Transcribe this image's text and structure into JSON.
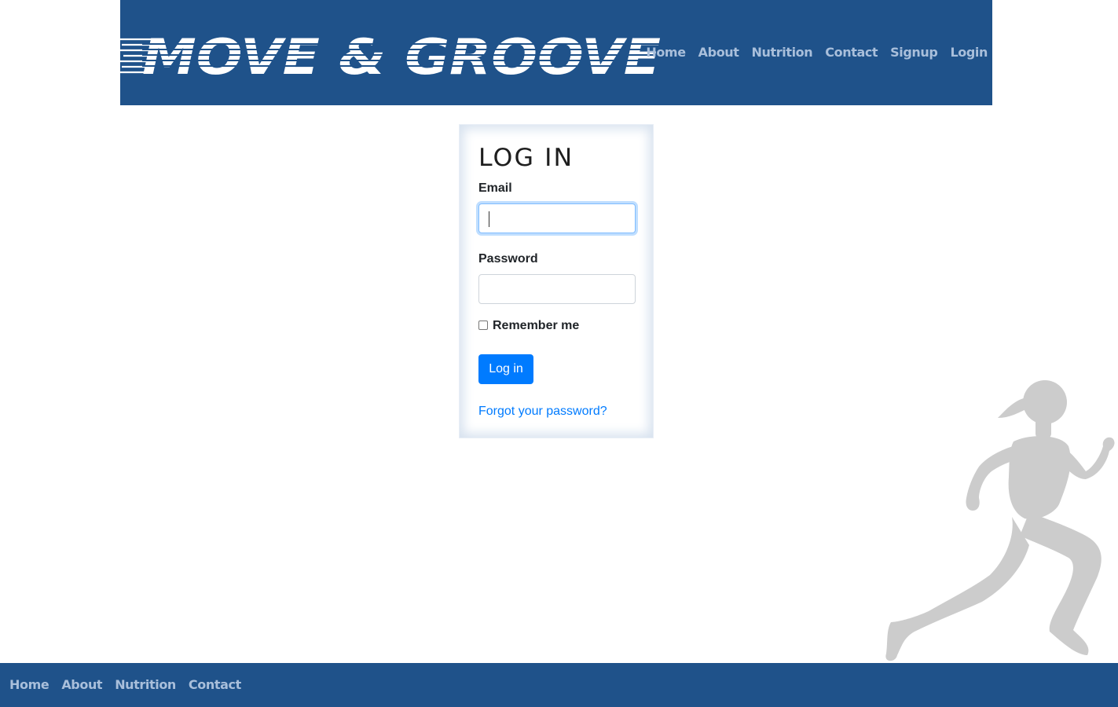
{
  "header": {
    "logo_text": "MOVE & GROOVE",
    "nav": [
      "Home",
      "About",
      "Nutrition",
      "Contact",
      "Signup",
      "Login"
    ]
  },
  "login": {
    "title": "LOG IN",
    "email_label": "Email",
    "email_value": "",
    "password_label": "Password",
    "password_value": "",
    "remember_label": "Remember me",
    "remember_checked": false,
    "submit_label": "Log in",
    "forgot_label": "Forgot your password?"
  },
  "footer": {
    "nav": [
      "Home",
      "About",
      "Nutrition",
      "Contact"
    ]
  },
  "colors": {
    "brand_blue": "#1f528a",
    "nav_text": "#a9bfdb",
    "primary": "#007bff",
    "silhouette": "#cccccc"
  },
  "icons": {
    "runner": "running-woman-silhouette"
  }
}
